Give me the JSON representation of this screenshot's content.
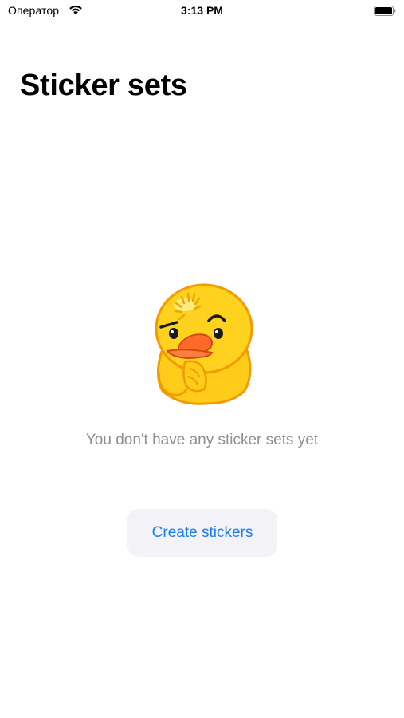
{
  "status_bar": {
    "carrier": "Оператор",
    "time": "3:13 PM",
    "wifi_icon": "wifi-icon",
    "battery_icon": "battery-icon"
  },
  "header": {
    "title": "Sticker sets"
  },
  "empty_state": {
    "illustration": "duck-sticker-icon",
    "message": "You don't have any sticker sets yet",
    "create_button_label": "Create stickers"
  },
  "colors": {
    "accent": "#1a7ef0",
    "secondary_text": "#8e8e93",
    "button_background": "#f2f2f7",
    "duck_yellow": "#ffcc1a",
    "duck_outline": "#f29a00",
    "beak": "#ff6a2b"
  }
}
